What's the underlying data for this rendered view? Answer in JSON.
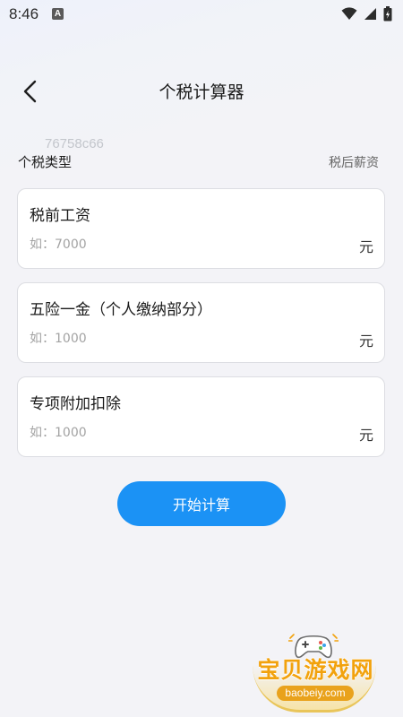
{
  "status_bar": {
    "time": "8:46",
    "notification_icon": "A",
    "icons": [
      "wifi-icon",
      "signal-icon",
      "battery-icon"
    ]
  },
  "header": {
    "back_icon": "chevron-left-icon",
    "title": "个税计算器"
  },
  "watermark_code": "76758c66",
  "tax_type": {
    "label": "个税类型",
    "after_tax_link": "税后薪资"
  },
  "fields": [
    {
      "title": "税前工资",
      "placeholder": "如：7000",
      "value": "",
      "unit": "元"
    },
    {
      "title": "五险一金（个人缴纳部分）",
      "placeholder": "如：1000",
      "value": "",
      "unit": "元"
    },
    {
      "title": "专项附加扣除",
      "placeholder": "如：1000",
      "value": "",
      "unit": "元"
    }
  ],
  "calculate_button": "开始计算",
  "logo": {
    "text": "宝贝游戏网",
    "domain": "baobeiy.com"
  },
  "colors": {
    "accent": "#1b92f5",
    "logo_orange": "#f2a20d"
  }
}
